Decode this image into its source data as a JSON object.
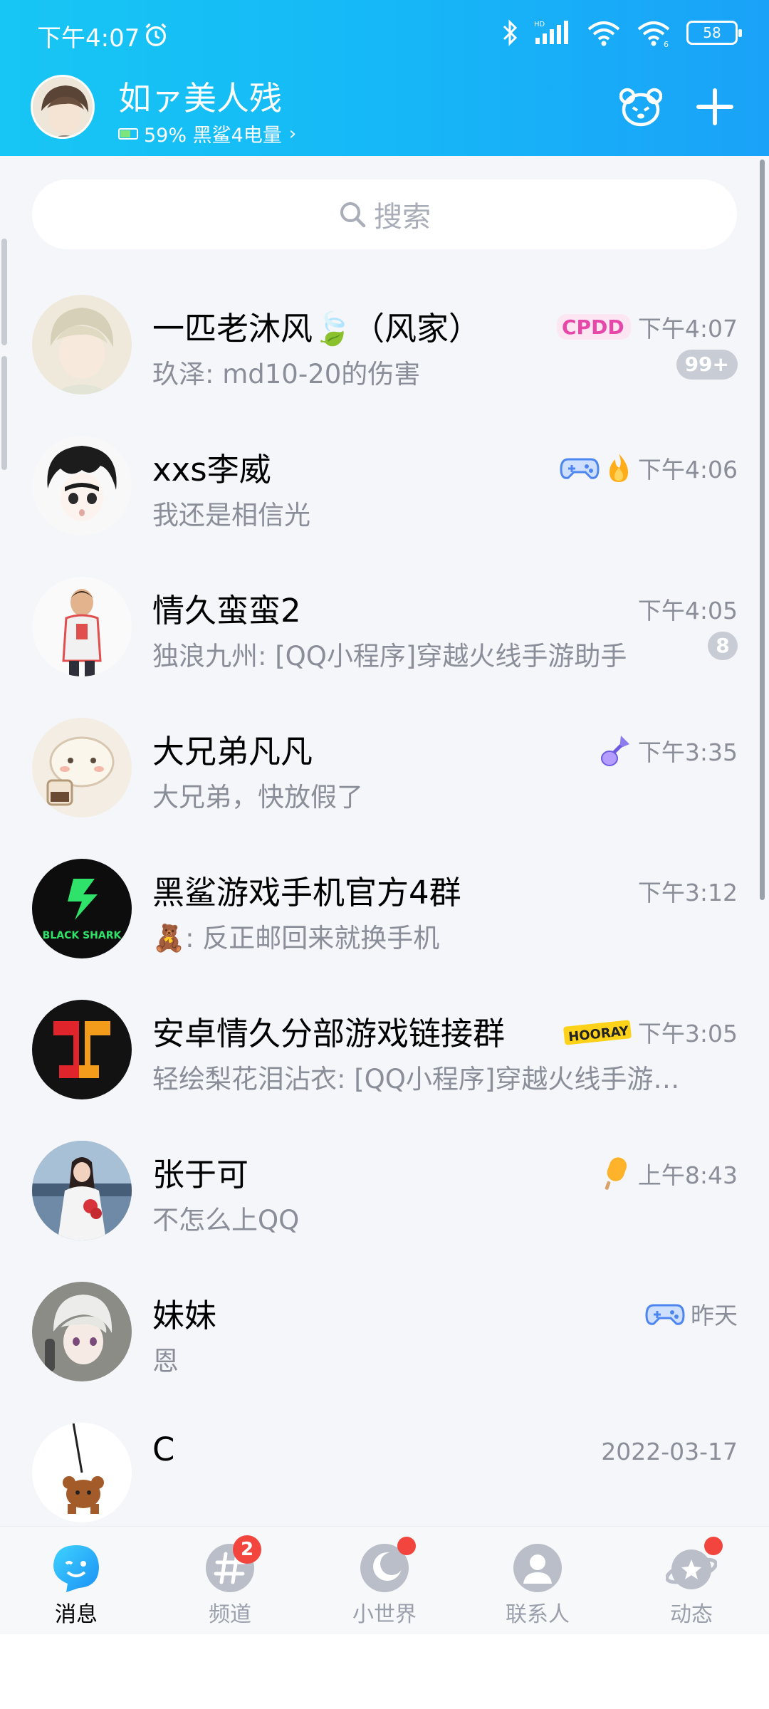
{
  "status_bar": {
    "time": "下午4:07",
    "battery": "58",
    "hd_label": "HD"
  },
  "header": {
    "nickname": "如ァ美人残",
    "device_status": "59% 黑鲨4电量",
    "accent_color": "#16b8f7"
  },
  "search": {
    "placeholder": "搜索"
  },
  "conversations": [
    {
      "name": "一匹老沐风🍃（风家）",
      "message": "玖泽: md10-20的伤害",
      "time": "下午4:07",
      "badge": "99+",
      "tag_icon": "cpdd-icon"
    },
    {
      "name": "xxs李威",
      "message": "我还是相信光",
      "time": "下午4:06",
      "badge": "",
      "tag_icon": "gamepad-icon, fire-icon"
    },
    {
      "name": "情久蛮蛮2",
      "message": "独浪九州: [QQ小程序]穿越火线手游助手",
      "time": "下午4:05",
      "badge": "8",
      "tag_icon": ""
    },
    {
      "name": "大兄弟凡凡",
      "message": "大兄弟，快放假了",
      "time": "下午3:35",
      "badge": "",
      "tag_icon": "guitar-icon"
    },
    {
      "name": "黑鲨游戏手机官方4群",
      "message": "🧸: 反正邮回来就换手机",
      "time": "下午3:12",
      "badge": "",
      "tag_icon": ""
    },
    {
      "name": "安卓情久分部游戏链接群",
      "message": "轻绘梨花泪沾衣: [QQ小程序]穿越火线手游…",
      "time": "下午3:05",
      "badge": "",
      "tag_icon": "hooray-icon"
    },
    {
      "name": "张于可",
      "message": "不怎么上QQ",
      "time": "上午8:43",
      "badge": "",
      "tag_icon": "popsicle-icon"
    },
    {
      "name": "妹妹",
      "message": "恩",
      "time": "昨天",
      "badge": "",
      "tag_icon": "gamepad-icon"
    },
    {
      "name": "C",
      "message": "",
      "time": "2022-03-17",
      "badge": "",
      "tag_icon": ""
    }
  ],
  "logos": {
    "black_shark": "BLACK SHARK",
    "hooray": "HOORAY",
    "cpdd": "CPDD"
  },
  "bottom_nav": [
    {
      "label": "消息",
      "badge": ""
    },
    {
      "label": "频道",
      "badge": "2"
    },
    {
      "label": "小世界",
      "badge": "dot"
    },
    {
      "label": "联系人",
      "badge": ""
    },
    {
      "label": "动态",
      "badge": "dot"
    }
  ]
}
